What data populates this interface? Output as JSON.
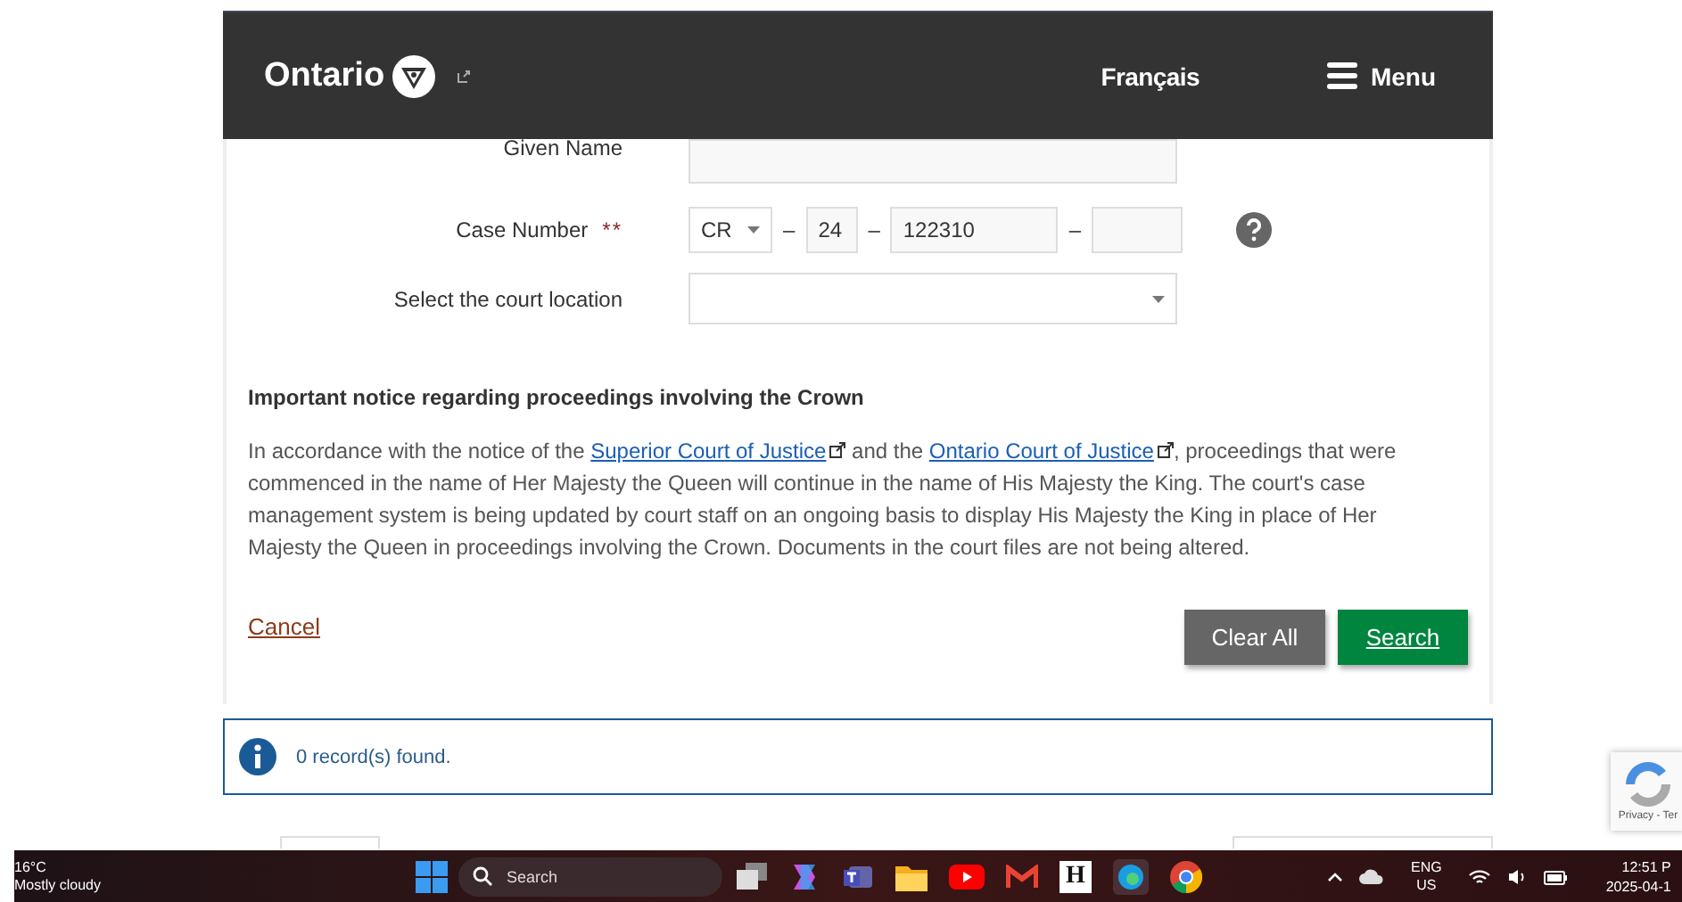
{
  "header": {
    "logo": "Ontario",
    "language_link": "Français",
    "menu_button": "Menu"
  },
  "form": {
    "given_name": {
      "label": "Given Name"
    },
    "case_number": {
      "label": "Case Number",
      "required_mark": "**",
      "prefix": "CR",
      "year": "24",
      "number": "122310",
      "separators": [
        "–",
        "–",
        "–"
      ]
    },
    "court_location": {
      "label": "Select the court location"
    }
  },
  "notice": {
    "title": "Important notice regarding proceedings involving the Crown",
    "parts": [
      {
        "kind": "text",
        "text": "In accordance with the notice of the "
      },
      {
        "kind": "link",
        "text": "Superior Court of Justice"
      },
      {
        "kind": "text",
        "text": " and the "
      },
      {
        "kind": "link",
        "text": "Ontario Court of Justice"
      },
      {
        "kind": "text",
        "text": ", proceedings that were commenced in the name of Her Majesty the Queen will continue in the name of His Majesty the King. The court's case management system is being updated by court staff on an ongoing basis to display His Majesty the King in place of Her Majesty the Queen in proceedings involving the Crown. Documents in the court files are not being altered."
      }
    ]
  },
  "actions": {
    "cancel": "Cancel",
    "clear": "Clear All",
    "search": "Search"
  },
  "results": {
    "message": "0 record(s) found."
  },
  "recaptcha": {
    "links": "Privacy - Ter"
  },
  "taskbar": {
    "temperature": "16°C",
    "weather": "Mostly cloudy",
    "search_placeholder": "Search",
    "app_letter": "H",
    "language": "ENG",
    "region": "US",
    "time": "12:51 P",
    "date": "2025-04-1"
  }
}
